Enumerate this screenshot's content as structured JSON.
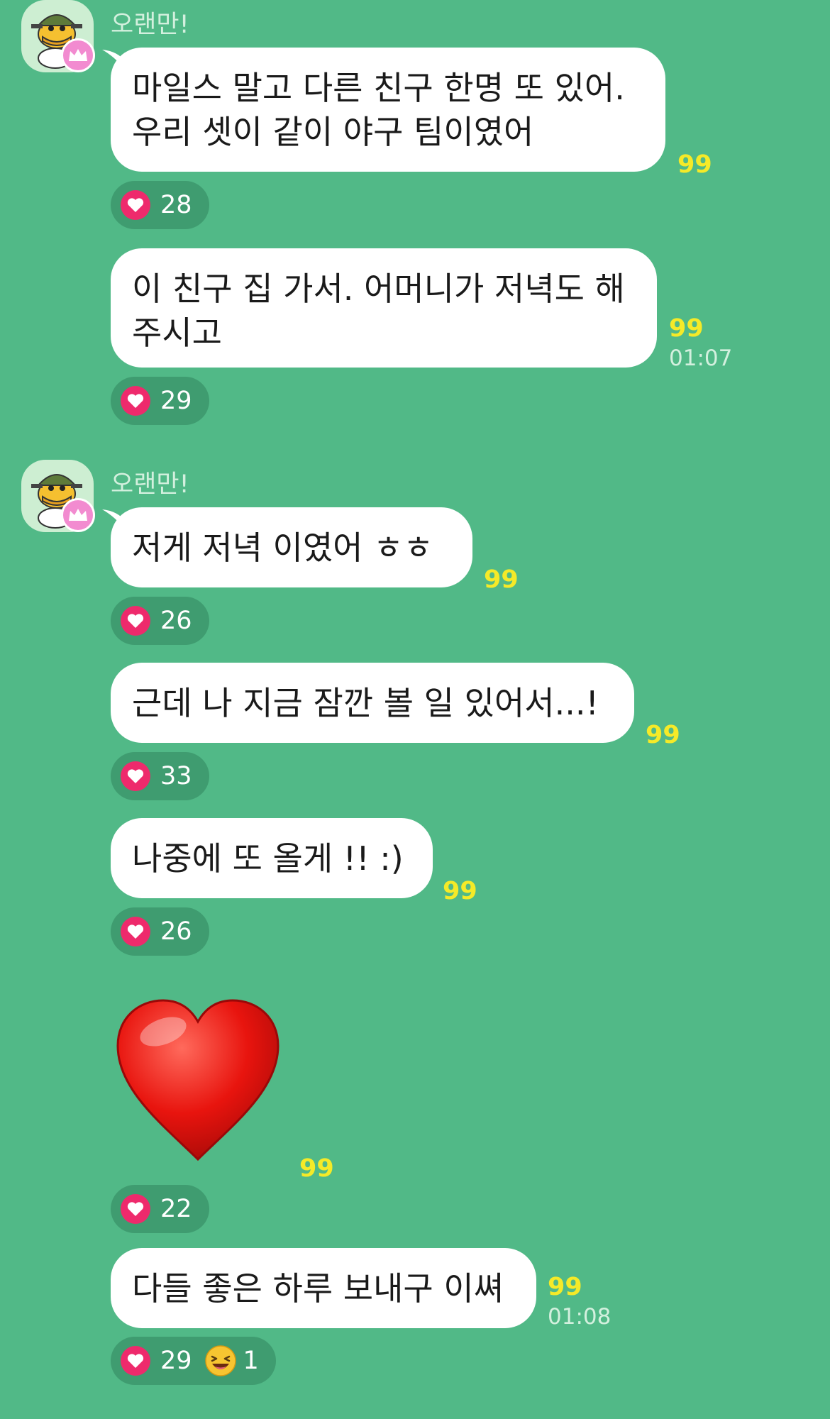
{
  "colors": {
    "chat_background": "#51b987",
    "bubble": "#ffffff",
    "read_count": "#f5ea28",
    "reaction_pill": "#3f9c70",
    "reaction_heart": "#ee2a6c",
    "sender_name": "#d3f0de"
  },
  "groups": [
    {
      "sender": "오랜만!",
      "avatar_icon": "duck-soldier-avatar-icon",
      "badge_icon": "crown-icon",
      "messages": [
        {
          "lines": [
            "마일스 말고 다른 친구 한명 또 있어.",
            "우리 셋이 같이 야구 팀이였어"
          ],
          "read_count": "99",
          "reactions": [
            {
              "icon": "heart-icon",
              "count": "28"
            }
          ]
        },
        {
          "lines": [
            "이 친구 집 가서. 어머니가 저녁도 해",
            "주시고"
          ],
          "read_count": "99",
          "time": "01:07",
          "reactions": [
            {
              "icon": "heart-icon",
              "count": "29"
            }
          ]
        }
      ]
    },
    {
      "sender": "오랜만!",
      "avatar_icon": "duck-soldier-avatar-icon",
      "badge_icon": "crown-icon",
      "messages": [
        {
          "lines": [
            "저게 저녁 이였어 ㅎㅎ"
          ],
          "read_count": "99",
          "reactions": [
            {
              "icon": "heart-icon",
              "count": "26"
            }
          ]
        },
        {
          "lines": [
            "근데 나 지금 잠깐 볼 일 있어서...!"
          ],
          "read_count": "99",
          "reactions": [
            {
              "icon": "heart-icon",
              "count": "33"
            }
          ]
        },
        {
          "lines": [
            "나중에 또 올게 !! :)"
          ],
          "read_count": "99",
          "reactions": [
            {
              "icon": "heart-icon",
              "count": "26"
            }
          ]
        },
        {
          "emoji": "red-heart-emoji",
          "read_count": "99",
          "reactions": [
            {
              "icon": "heart-icon",
              "count": "22"
            }
          ]
        },
        {
          "lines": [
            "다들 좋은 하루 보내구 이쎠"
          ],
          "read_count": "99",
          "time": "01:08",
          "reactions": [
            {
              "icon": "heart-icon",
              "count": "29"
            },
            {
              "icon": "grinning-squint-emoji-icon",
              "count": "1"
            }
          ]
        }
      ]
    }
  ]
}
